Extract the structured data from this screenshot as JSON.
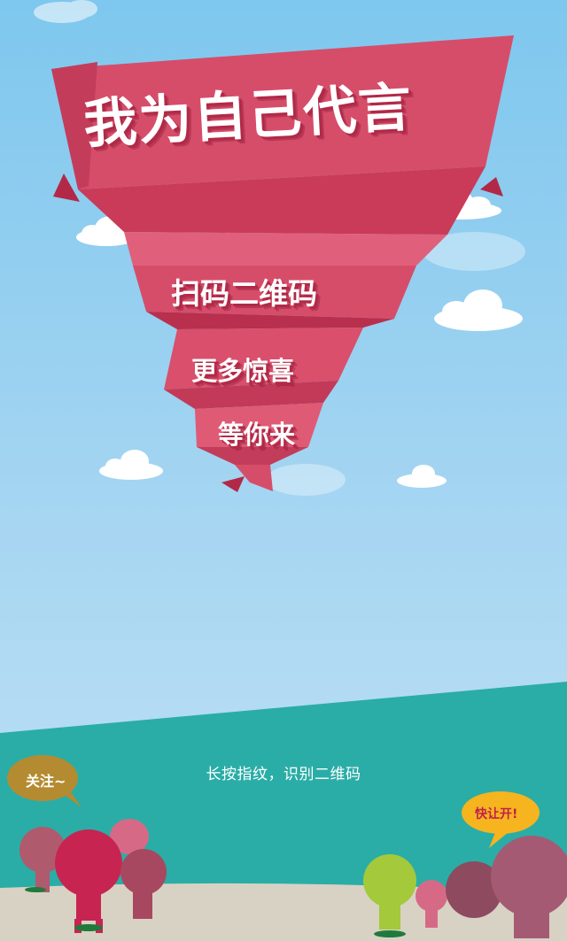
{
  "banner": {
    "title": "我为自己代言",
    "line1": "扫码二维码",
    "line2": "更多惊喜",
    "line3": "等你来"
  },
  "footer": {
    "hint": "长按指纹，识别二维码",
    "bubble_left": "关注~",
    "bubble_right": "快让开!"
  },
  "colors": {
    "sky_top": "#7ec7ee",
    "banner_red": "#d64d6a",
    "banner_dark": "#b22947",
    "sea": "#2aada6",
    "sand": "#d8d2c4",
    "bubble_gold": "#b48b30",
    "bubble_yellow": "#f6b41f"
  }
}
